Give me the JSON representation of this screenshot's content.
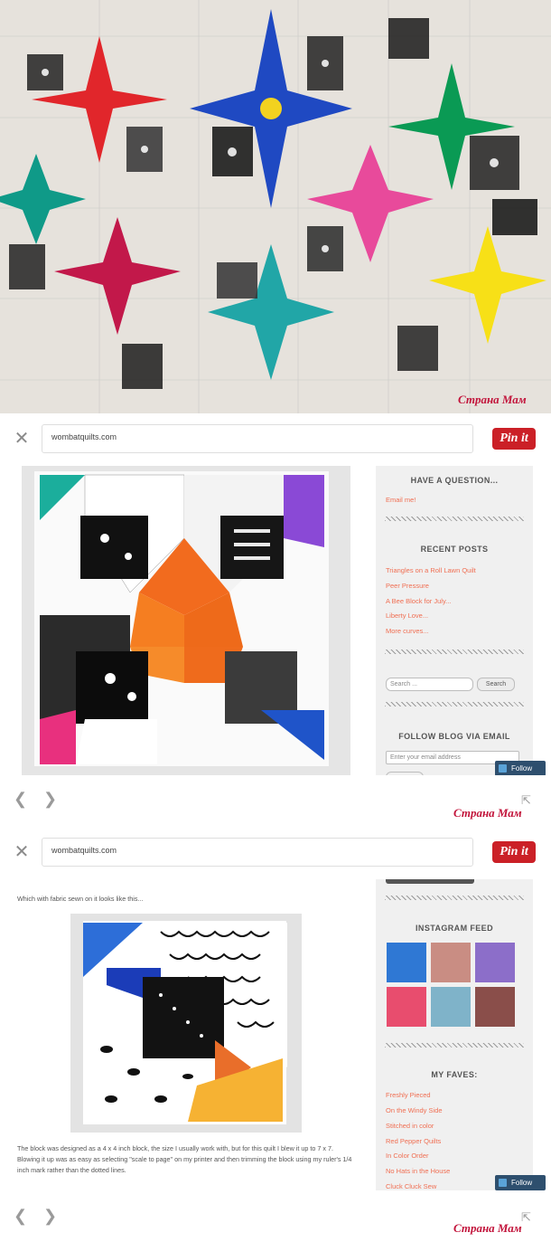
{
  "screens": [
    {
      "url": "wombatquilts.com",
      "pin_label": "Pin it"
    },
    {
      "url": "wombatquilts.com",
      "pin_label": "Pin it"
    }
  ],
  "watermark": "Страна Мам",
  "sidebar1": {
    "have_question": "HAVE A QUESTION...",
    "email_me": "Email me!",
    "recent_posts_title": "RECENT POSTS",
    "recent_posts": [
      "Triangles on a Roll Lawn Quilt",
      "Peer Pressure",
      "A Bee Block for July...",
      "Liberty Love...",
      "More curves..."
    ],
    "search_placeholder": "Search ...",
    "search_button": "Search",
    "follow_title": "FOLLOW BLOG VIA EMAIL",
    "email_placeholder": "Enter your email address"
  },
  "follow_label": "Follow",
  "sidebar2": {
    "instagram_title": "INSTAGRAM FEED",
    "faves_title": "MY FAVES:",
    "faves": [
      "Freshly Pieced",
      "On the Windy Side",
      "Stitched in color",
      "Red Pepper Quilts",
      "In Color Order",
      "No Hats in the House",
      "Cluck Cluck Sew"
    ]
  },
  "post": {
    "intro": "Which with fabric sewn on it looks like this...",
    "paragraph": "The block was designed as a  4 x 4 inch block, the size I usually work with,  but for this quilt I blew it up to 7 x 7.   Blowing it up was as easy as selecting \"scale to page\" on my printer and then trimming the block using my ruler's 1/4 inch mark rather than the dotted lines."
  },
  "colors": {
    "pin_red": "#cb2027",
    "link_orange": "#f06f53",
    "follow_blue": "#2e4f6e",
    "sidebar_bg": "#f0f0f0"
  },
  "icons": [
    "close-icon",
    "back-arrow-icon",
    "forward-arrow-icon",
    "external-link-icon"
  ]
}
